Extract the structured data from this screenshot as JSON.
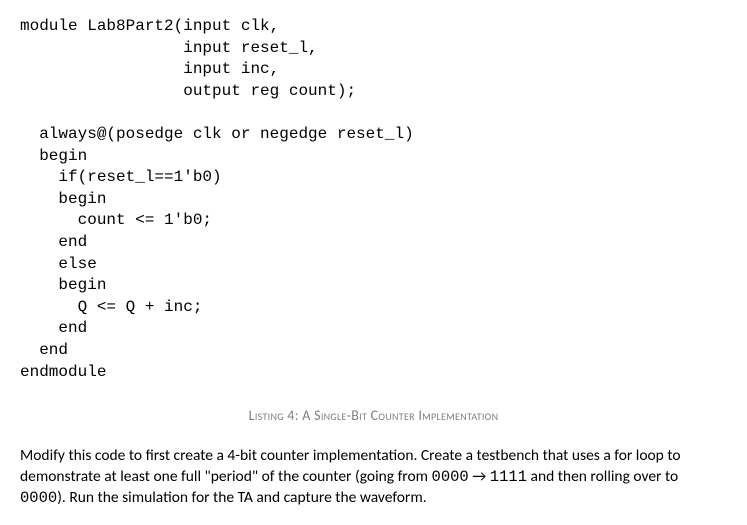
{
  "code": {
    "l1": "module Lab8Part2(input clk,",
    "l2": "                 input reset_l,",
    "l3": "                 input inc,",
    "l4": "                 output reg count);",
    "l5": "",
    "l6": "  always@(posedge clk or negedge reset_l)",
    "l7": "  begin",
    "l8": "    if(reset_l==1'b0)",
    "l9": "    begin",
    "l10": "      count <= 1'b0;",
    "l11": "    end",
    "l12": "    else",
    "l13": "    begin",
    "l14": "      Q <= Q + inc;",
    "l15": "    end",
    "l16": "  end",
    "l17": "endmodule"
  },
  "caption": "Listing 4: A Single-Bit Counter Implementation",
  "para": {
    "s1": "Modify this code to first create a 4-bit counter implementation. Create a testbench that uses a for loop to demonstrate at least one full \"period\" of the counter (going from ",
    "m1": "0000",
    "s2": " → ",
    "m2": "1111",
    "s3": " and then rolling over to ",
    "m3": "0000",
    "s4": "). Run the simulation for the TA and capture the waveform."
  }
}
